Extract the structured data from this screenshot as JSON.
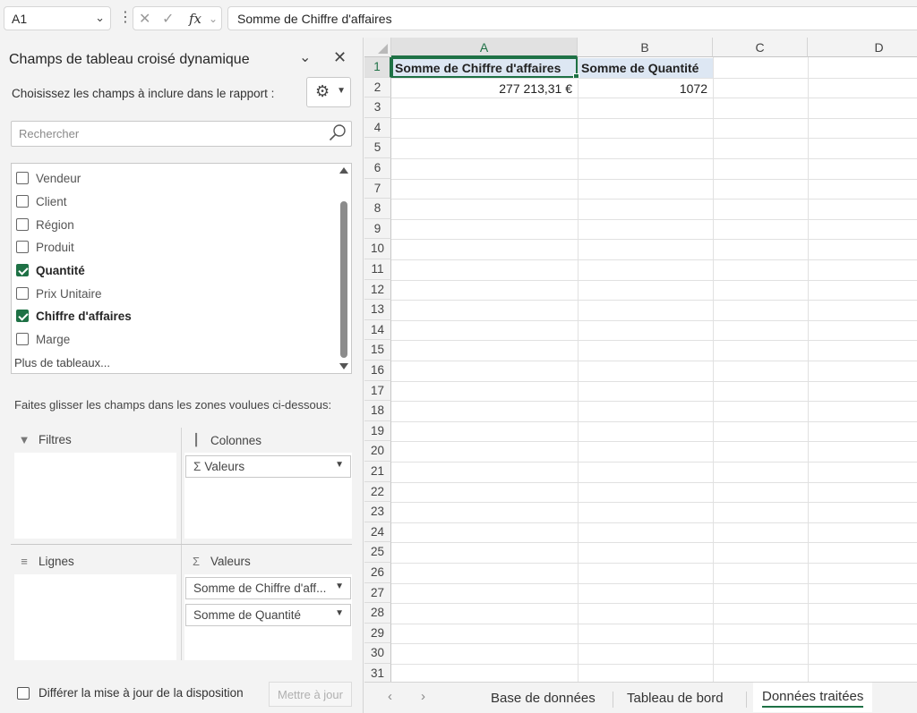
{
  "formula_bar": {
    "name_box": "A1",
    "fx_label": "fx",
    "formula": "Somme de Chiffre d'affaires"
  },
  "pivot_panel": {
    "title": "Champs de tableau croisé dynamique",
    "choose_label": "Choisissez les champs à inclure dans le rapport :",
    "search_placeholder": "Rechercher",
    "fields": [
      {
        "label": "Vendeur",
        "checked": false
      },
      {
        "label": "Client",
        "checked": false
      },
      {
        "label": "Région",
        "checked": false
      },
      {
        "label": "Produit",
        "checked": false
      },
      {
        "label": "Quantité",
        "checked": true
      },
      {
        "label": "Prix Unitaire",
        "checked": false
      },
      {
        "label": "Chiffre d'affaires",
        "checked": true
      },
      {
        "label": "Marge",
        "checked": false
      }
    ],
    "more_tables": "Plus de tableaux...",
    "drag_hint": "Faites glisser les champs dans les zones voulues ci-dessous:",
    "zones": {
      "filters": "Filtres",
      "columns": "Colonnes",
      "rows": "Lignes",
      "values": "Valeurs"
    },
    "columns_items": [
      "Valeurs"
    ],
    "values_items": [
      "Somme de Chiffre d'aff...",
      "Somme de Quantité"
    ],
    "defer_label": "Différer la mise à jour de la disposition",
    "update_button": "Mettre à jour"
  },
  "sheet": {
    "columns": [
      "A",
      "B",
      "C",
      "D"
    ],
    "rows": [
      "1",
      "2",
      "3",
      "4",
      "5",
      "6",
      "7",
      "8",
      "9",
      "10",
      "11",
      "12",
      "13",
      "14",
      "15",
      "16",
      "17",
      "18",
      "19",
      "20",
      "21",
      "22",
      "23",
      "24",
      "25",
      "26",
      "27",
      "28",
      "29",
      "30",
      "31"
    ],
    "cells": {
      "A1": "Somme de Chiffre d'affaires",
      "B1": "Somme de Quantité",
      "A2": "277 213,31 €",
      "B2": "1072"
    },
    "selected_cell": "A1"
  },
  "tabs": [
    {
      "label": "Base de données",
      "active": false
    },
    {
      "label": "Tableau de bord",
      "active": false
    },
    {
      "label": "Données traitées",
      "active": true
    }
  ],
  "colors": {
    "accent": "#1e7145",
    "header_fill": "#dde7f3"
  }
}
